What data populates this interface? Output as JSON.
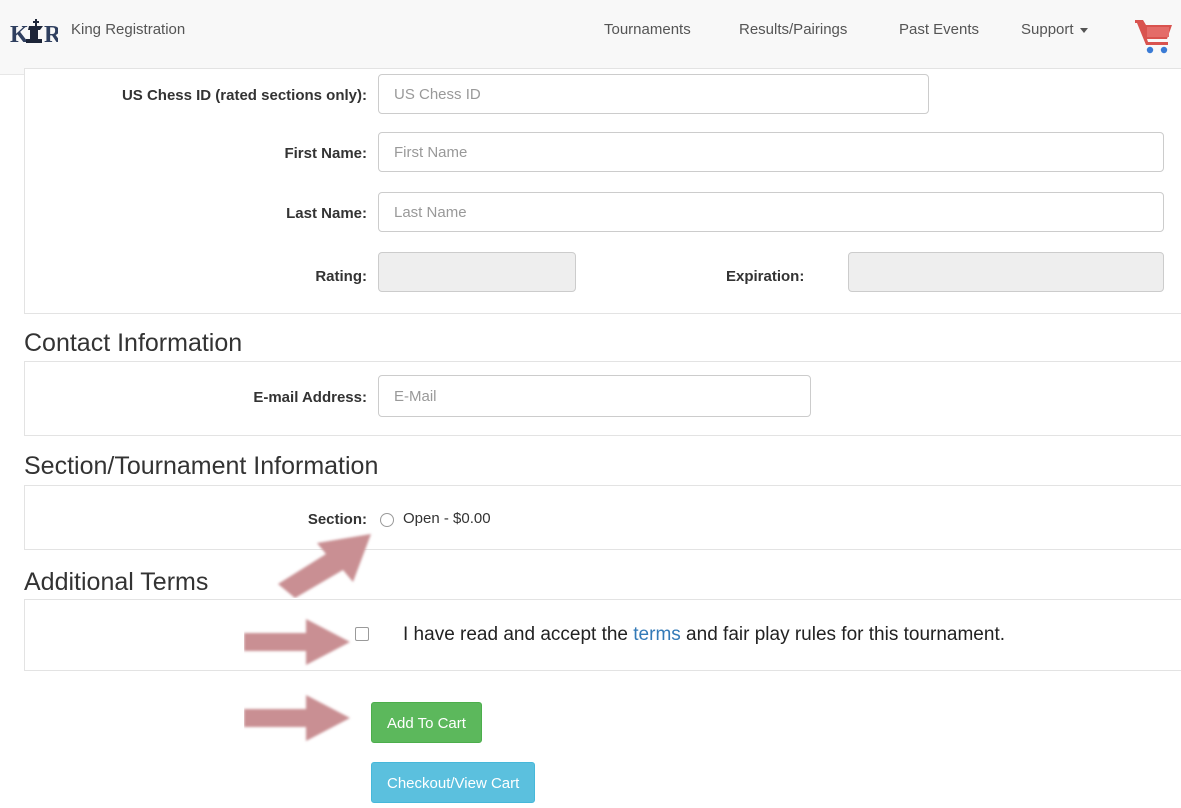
{
  "navbar": {
    "brand": "King Registration",
    "links": [
      "Tournaments",
      "Results/Pairings",
      "Past Events",
      "Support"
    ],
    "cart_color": "#d9534f"
  },
  "player": {
    "uscf_label": "US Chess ID (rated sections only):",
    "uscf_placeholder": "US Chess ID",
    "first_label": "First Name:",
    "first_placeholder": "First Name",
    "last_label": "Last Name:",
    "last_placeholder": "Last Name",
    "rating_label": "Rating:",
    "expiration_label": "Expiration:"
  },
  "contact": {
    "title": "Contact Information",
    "email_label": "E-mail Address:",
    "email_placeholder": "E-Mail"
  },
  "section": {
    "title": "Section/Tournament Information",
    "label": "Section:",
    "option": "Open - $0.00"
  },
  "terms": {
    "title": "Additional Terms",
    "prefix": "I have read and accept the ",
    "link": "terms",
    "suffix": " and fair play rules for this tournament."
  },
  "buttons": {
    "add_to_cart": "Add To Cart",
    "checkout": "Checkout/View Cart"
  },
  "colors": {
    "arrow": "#c98f93",
    "link": "#337ab7",
    "success": "#5cb85c",
    "info": "#5bc0de"
  }
}
